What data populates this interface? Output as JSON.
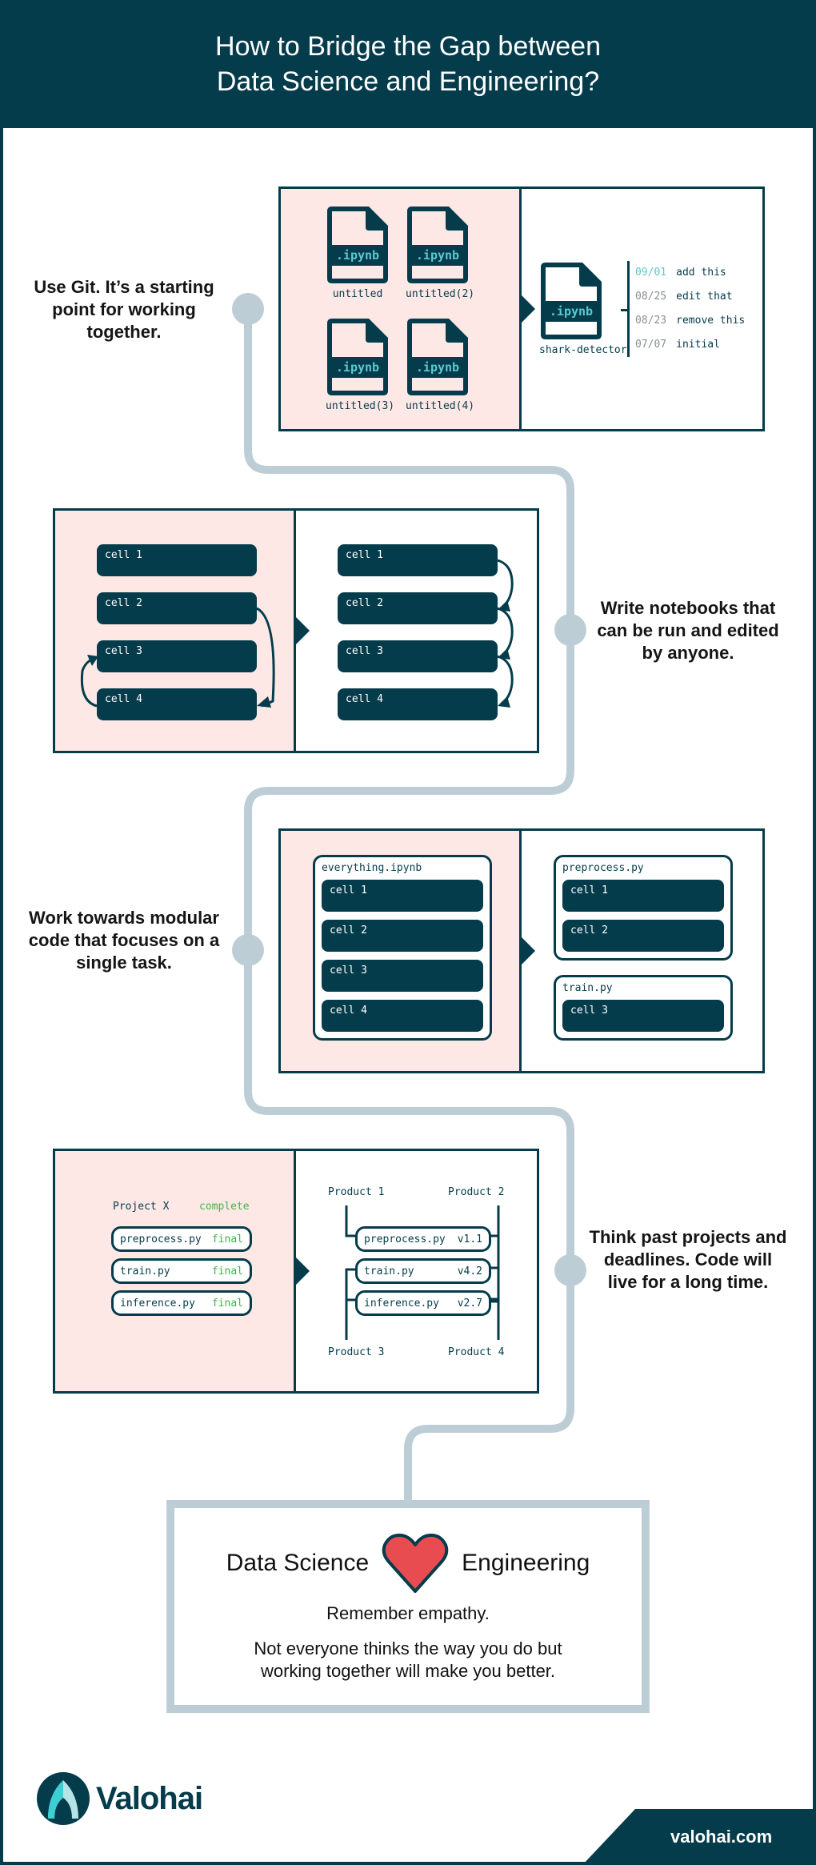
{
  "header": {
    "title_line1": "How to Bridge the Gap between",
    "title_line2": "Data Science and Engineering?"
  },
  "colors": {
    "primary": "#043c4b",
    "panel_pink": "#fde8e6",
    "path": "#bdcdd6",
    "accent_cyan": "#5cc8d0",
    "status_green": "#3cb54a",
    "heart": "#e84c51"
  },
  "steps": [
    {
      "text": "Use Git. It’s a starting point  for working together.",
      "before": {
        "files": [
          {
            "ext": ".ipynb",
            "name": "untitled"
          },
          {
            "ext": ".ipynb",
            "name": "untitled(2)"
          },
          {
            "ext": ".ipynb",
            "name": "untitled(3)"
          },
          {
            "ext": ".ipynb",
            "name": "untitled(4)"
          }
        ]
      },
      "after": {
        "file": {
          "ext": ".ipynb",
          "name": "shark-detector"
        },
        "commits": [
          {
            "date": "09/01",
            "message": "add this",
            "highlight": true
          },
          {
            "date": "08/25",
            "message": "edit that",
            "highlight": false
          },
          {
            "date": "08/23",
            "message": "remove this",
            "highlight": false
          },
          {
            "date": "07/07",
            "message": "initial",
            "highlight": false
          }
        ]
      }
    },
    {
      "text": "Write notebooks that can be run and edited by anyone.",
      "before": {
        "cells": [
          "cell 1",
          "cell 2",
          "cell 3",
          "cell 4"
        ]
      },
      "after": {
        "cells": [
          "cell 1",
          "cell 2",
          "cell 3",
          "cell 4"
        ]
      }
    },
    {
      "text": "Work towards modular code that focuses on a single task.",
      "before": {
        "notebook": "everything.ipynb",
        "cells": [
          "cell 1",
          "cell 2",
          "cell 3",
          "cell 4"
        ]
      },
      "after": {
        "modules": [
          {
            "name": "preprocess.py",
            "cells": [
              "cell 1",
              "cell 2"
            ]
          },
          {
            "name": "train.py",
            "cells": [
              "cell 3"
            ]
          }
        ]
      }
    },
    {
      "text": "Think past projects and deadlines. Code will live for a long time.",
      "before": {
        "project": "Project X",
        "project_status": "complete",
        "files": [
          {
            "name": "preprocess.py",
            "status": "final"
          },
          {
            "name": "train.py",
            "status": "final"
          },
          {
            "name": "inference.py",
            "status": "final"
          }
        ]
      },
      "after": {
        "products": [
          "Product 1",
          "Product 2",
          "Product 3",
          "Product 4"
        ],
        "files": [
          {
            "name": "preprocess.py",
            "version": "v1.1"
          },
          {
            "name": "train.py",
            "version": "v4.2"
          },
          {
            "name": "inference.py",
            "version": "v2.7"
          }
        ]
      }
    }
  ],
  "conclusion": {
    "left": "Data Science",
    "right": "Engineering",
    "icon": "heart-icon",
    "line1": "Remember empathy.",
    "line2a": "Not everyone thinks the way you do but",
    "line2b": "working together will make you better."
  },
  "footer": {
    "brand": "Valohai",
    "url": "valohai.com"
  }
}
